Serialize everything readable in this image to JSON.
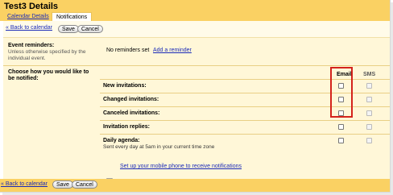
{
  "page": {
    "title": "Test3 Details"
  },
  "tabs": [
    {
      "label": "Calendar Details"
    },
    {
      "label": "Notifications"
    }
  ],
  "topbar": {
    "back_link": "« Back to calendar",
    "save": "Save",
    "cancel": "Cancel"
  },
  "event_reminders": {
    "label": "Event reminders:",
    "sub": "Unless otherwise specified by the individual event.",
    "value": "No reminders set",
    "add_link": "Add a reminder"
  },
  "notify": {
    "label": "Choose how you would like to be notified:",
    "col_email": "Email",
    "col_sms": "SMS",
    "rows": [
      {
        "label": "New invitations:",
        "email": false,
        "sms_disabled": true
      },
      {
        "label": "Changed invitations:",
        "email": false,
        "sms_disabled": true
      },
      {
        "label": "Canceled invitations:",
        "email": false,
        "sms_disabled": true
      },
      {
        "label": "Invitation replies:",
        "email": false,
        "sms_disabled": true
      },
      {
        "label": "Daily agenda:",
        "sub": "Sent every day at 5am in your current time zone",
        "email": false,
        "sms_disabled": true
      }
    ],
    "mobile_link": "Set up your mobile phone to receive notifications"
  },
  "bottombar": {
    "back_link": "« Back to calendar",
    "save": "Save",
    "cancel": "Cancel"
  },
  "colors": {
    "header": "#fad163",
    "highlight": "#d4231c",
    "link": "#1b2bb8"
  }
}
